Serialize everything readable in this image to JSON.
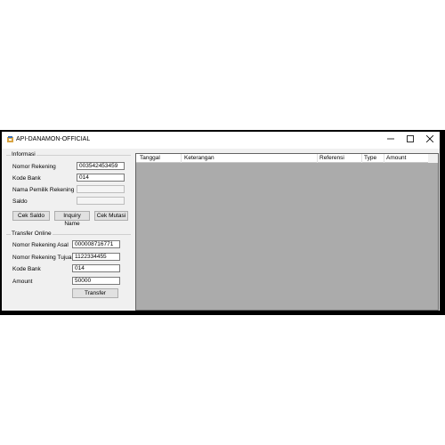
{
  "window": {
    "title": "API-DANAMON-OFFICIAL",
    "controls": {
      "minimize_icon": "minimize-icon",
      "maximize_icon": "maximize-icon",
      "close_icon": "close-icon"
    }
  },
  "informasi": {
    "title": "Informasi",
    "fields": [
      {
        "label": "Nomor Rekening",
        "value": "003542453459"
      },
      {
        "label": "Kode Bank",
        "value": "014"
      },
      {
        "label": "Nama Pemilik Rekening",
        "value": ""
      },
      {
        "label": "Saldo",
        "value": ""
      }
    ],
    "buttons": {
      "cek_saldo": "Cek Saldo",
      "inquiry_name": "Inquiry Name",
      "cek_mutasi": "Cek Mutasi"
    }
  },
  "transfer": {
    "title": "Transfer Online",
    "fields": [
      {
        "label": "Nomor Rekening Asal",
        "value": "000008716771"
      },
      {
        "label": "Nomor Rekening Tujuan",
        "value": "1122334455"
      },
      {
        "label": "Kode Bank",
        "value": "014"
      },
      {
        "label": "Amount",
        "value": "50000"
      }
    ],
    "button": "Transfer"
  },
  "grid": {
    "columns": [
      "Tanggal",
      "Keterangan",
      "Referensi",
      "Type",
      "Amount"
    ]
  }
}
